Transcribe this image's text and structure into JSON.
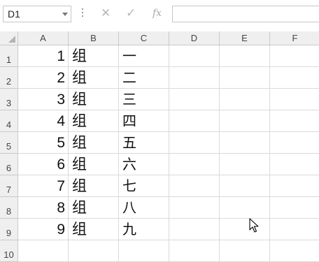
{
  "formula_bar": {
    "name_box": "D1",
    "cancel_icon": "✕",
    "enter_icon": "✓",
    "function_label": "fx",
    "formula_value": ""
  },
  "columns": [
    "A",
    "B",
    "C",
    "D",
    "E",
    "F"
  ],
  "rows": [
    "1",
    "2",
    "3",
    "4",
    "5",
    "6",
    "7",
    "8",
    "9",
    "10"
  ],
  "cells": {
    "A": [
      "1",
      "2",
      "3",
      "4",
      "5",
      "6",
      "7",
      "8",
      "9",
      ""
    ],
    "B": [
      "组",
      "组",
      "组",
      "组",
      "组",
      "组",
      "组",
      "组",
      "组",
      ""
    ],
    "C": [
      "一",
      "二",
      "三",
      "四",
      "五",
      "六",
      "七",
      "八",
      "九",
      ""
    ]
  },
  "selected_cell": "D1",
  "icons": {
    "name_box_dropdown": "chevron-down-icon",
    "cursor": "mouse-pointer-icon"
  }
}
